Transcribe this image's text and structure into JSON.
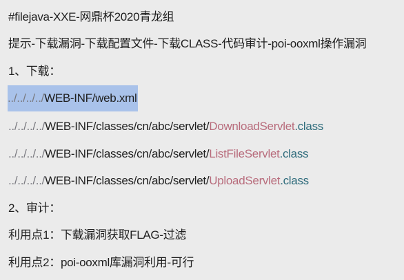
{
  "title": "#filejava-XXE-网鼎杯2020青龙组",
  "hint": "提示-下载漏洞-下载配置文件-下载CLASS-代码审计-poi-ooxml操作漏洞",
  "section1": "1、下载：",
  "paths": [
    {
      "prefix": "../../../../",
      "dir": "WEB-INF/web.xml",
      "name": "",
      "ext": ""
    },
    {
      "prefix": "../../../../",
      "dir": "WEB-INF/classes/cn/abc/servlet/",
      "name": "DownloadServlet",
      "ext": ".class"
    },
    {
      "prefix": "../../../../",
      "dir": "WEB-INF/classes/cn/abc/servlet/",
      "name": "ListFileServlet",
      "ext": ".class"
    },
    {
      "prefix": "../../../../",
      "dir": "WEB-INF/classes/cn/abc/servlet/",
      "name": "UploadServlet",
      "ext": ".class"
    }
  ],
  "section2": "2、审计：",
  "point1": "利用点1：下载漏洞获取FLAG-过滤",
  "point2": "利用点2：poi-ooxml库漏洞利用-可行",
  "colors": {
    "background": "#ebebeb",
    "selection": "#a9c2ea",
    "class_name": "#b86c7c",
    "extension": "#2f6c7c"
  }
}
